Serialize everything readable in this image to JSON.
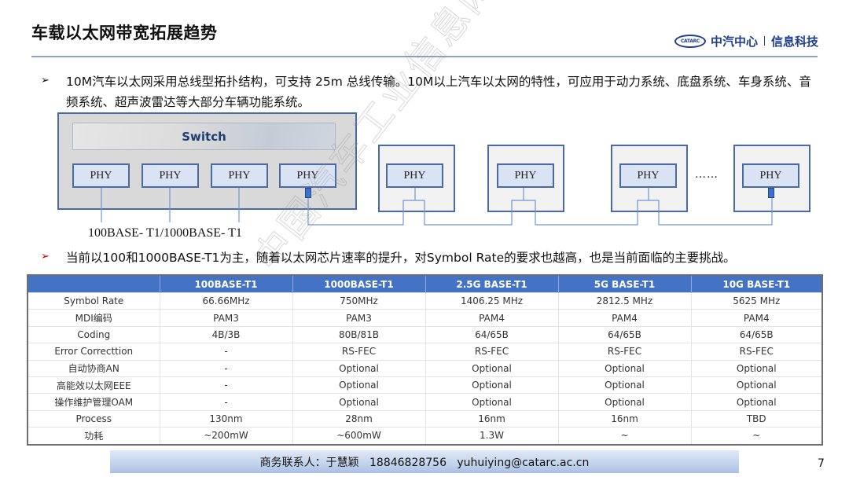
{
  "header": {
    "title": "车载以太网带宽拓展趋势",
    "logo_mark": "CATARC",
    "logo_org": "中汽中心",
    "logo_dept": "信息科技"
  },
  "bullets": [
    {
      "icon": "arrow-bullet-icon",
      "glyph": "➢",
      "text": "10M汽车以太网采用总线型拓扑结构，可支持 25m 总线传输。10M以上汽车以太网的特性，可应用于动力系统、底盘系统、车身系统、音频系统、超声波雷达等大部分车辆功能系统。"
    },
    {
      "icon": "arrow-bullet-icon",
      "glyph": "➢",
      "text": "当前以100和1000BASE-T1为主，随着以太网芯片速率的提升，对Symbol Rate的要求也越高，也是当前面临的主要挑战。"
    }
  ],
  "diagram": {
    "switch_label": "Switch",
    "phy_label": "PHY",
    "speed_label": "100BASE- T1/1000BASE- T1",
    "ellipsis": "……",
    "line_color": "#6f95d6",
    "box_border_color": "#4a6aa5"
  },
  "table": {
    "headers": [
      "",
      "100BASE-T1",
      "1000BASE-T1",
      "2.5G BASE-T1",
      "5G BASE-T1",
      "10G BASE-T1"
    ],
    "rows": [
      [
        "Symbol Rate",
        "66.66MHz",
        "750MHz",
        "1406.25 MHz",
        "2812.5 MHz",
        "5625 MHz"
      ],
      [
        "MDI编码",
        "PAM3",
        "PAM3",
        "PAM4",
        "PAM4",
        "PAM4"
      ],
      [
        "Coding",
        "4B/3B",
        "80B/81B",
        "64/65B",
        "64/65B",
        "64/65B"
      ],
      [
        "Error Correcttion",
        "-",
        "RS-FEC",
        "RS-FEC",
        "RS-FEC",
        "RS-FEC"
      ],
      [
        "自动协商AN",
        "-",
        "Optional",
        "Optional",
        "Optional",
        "Optional"
      ],
      [
        "高能效以太网EEE",
        "-",
        "Optional",
        "Optional",
        "Optional",
        "Optional"
      ],
      [
        "操作维护管理OAM",
        "-",
        "Optional",
        "Optional",
        "Optional",
        "Optional"
      ],
      [
        "Process",
        "130nm",
        "28nm",
        "16nm",
        "16nm",
        "TBD"
      ],
      [
        "功耗",
        "~200mW",
        "~600mW",
        "1.3W",
        "~",
        "~"
      ]
    ],
    "header_color": "#4472c4"
  },
  "footer": {
    "contact": "商务联系人：于慧颖   18846828756   yuhuiying@catarc.ac.cn",
    "page_number": "7"
  },
  "watermark": "中国汽车工业信息网"
}
